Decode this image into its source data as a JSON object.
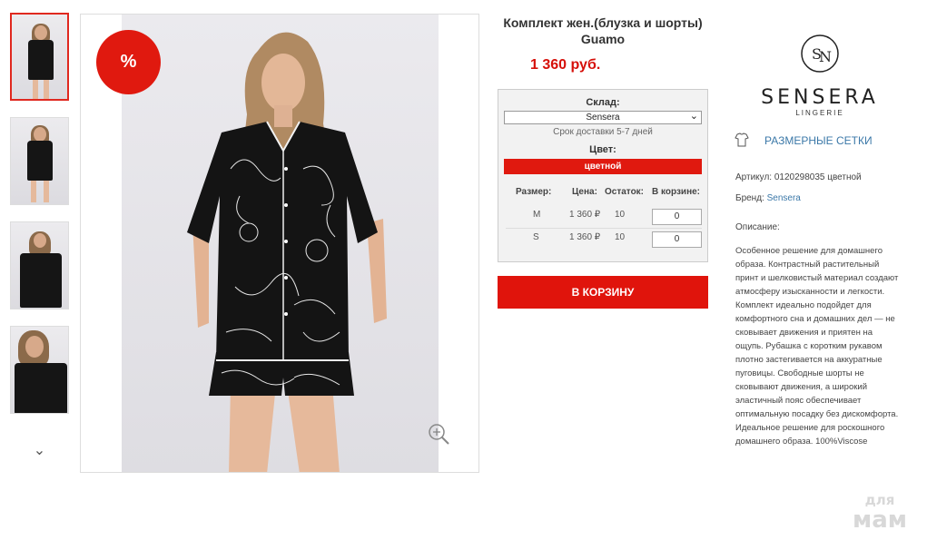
{
  "product": {
    "title": "Комплект жен.(блузка и шорты) Guamo",
    "price": "1 360 руб.",
    "sale_badge": "%"
  },
  "thumbnails": [
    {
      "name": "front-full",
      "active": true
    },
    {
      "name": "front-walk",
      "active": false
    },
    {
      "name": "front-crop",
      "active": false
    },
    {
      "name": "closeup",
      "active": false
    }
  ],
  "stock_box": {
    "warehouse_label": "Склад:",
    "warehouse_value": "Sensera",
    "delivery_text": "Срок доставки 5-7 дней",
    "color_label": "Цвет:",
    "color_value": "цветной",
    "headers": [
      "Размер:",
      "Цена:",
      "Остаток:",
      "В корзине:"
    ],
    "rows": [
      {
        "size": "M",
        "price": "1 360 ₽",
        "stock": "10",
        "qty": "0"
      },
      {
        "size": "S",
        "price": "1 360 ₽",
        "stock": "10",
        "qty": "0"
      }
    ]
  },
  "cart_button": "В КОРЗИНУ",
  "brand": {
    "name": "SENSERA",
    "sub": "LINGERIE",
    "size_charts_link": "РАЗМЕРНЫЕ СЕТКИ"
  },
  "details": {
    "article": "Артикул: 0120298035 цветной",
    "brand_label": "Бренд: ",
    "brand_value": "Sensera",
    "desc_label": "Описание:",
    "description": "Особенное решение для домашнего образа. Контрастный растительный принт и шелковистый материал создают атмосферу изысканности и легкости. Комплект идеально подойдет для комфортного сна и домашних дел — не сковывает движения и приятен на ощупь. Рубашка с коротким рукавом плотно застегивается на аккуратные пуговицы. Свободные шорты не сковывают движения, а широкий эластичный пояс обеспечивает оптимальную посадку без дискомфорта. Идеальное решение для роскошного домашнего образа. 100%Viscose"
  },
  "watermark": {
    "line1": "для",
    "line2": "мам"
  },
  "colors": {
    "accent": "#e0190f",
    "link": "#3b78a8"
  },
  "icons": [
    "zoom-icon",
    "chevron-down-icon",
    "size-chart-icon",
    "brand-logo-icon"
  ]
}
